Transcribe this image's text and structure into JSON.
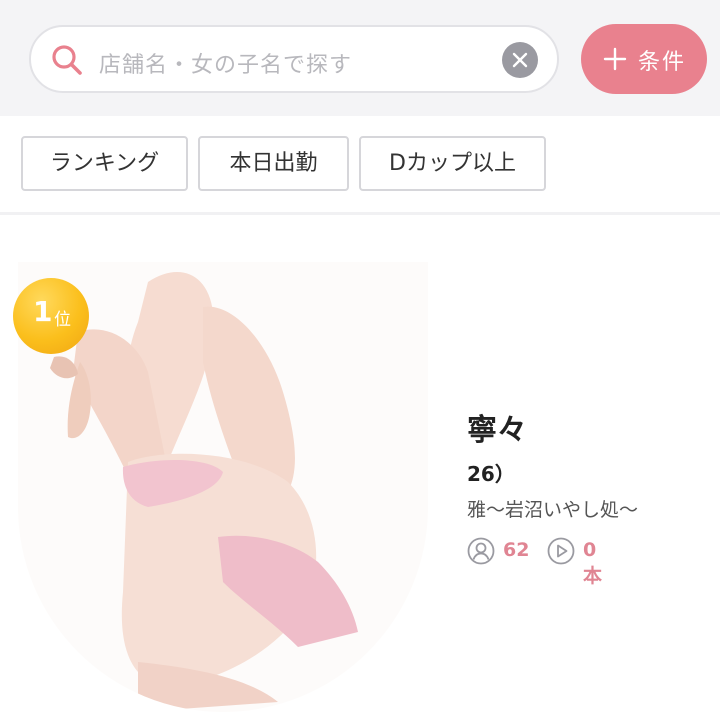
{
  "search": {
    "placeholder": "店舗名・女の子名で探す"
  },
  "condition_button": {
    "label": "条件"
  },
  "filters": [
    "ランキング",
    "本日出勤",
    "Dカップ以上"
  ],
  "ranking_card": {
    "rank_number": "1",
    "rank_suffix": "位",
    "name": "寧々",
    "age": "26）",
    "shop": "雅～岩沼いやし処～",
    "followers": "62",
    "videos": "0本"
  },
  "colors": {
    "accent": "#e9818e",
    "rank_badge": "#fbbf1c",
    "stat_text": "#e08593"
  }
}
